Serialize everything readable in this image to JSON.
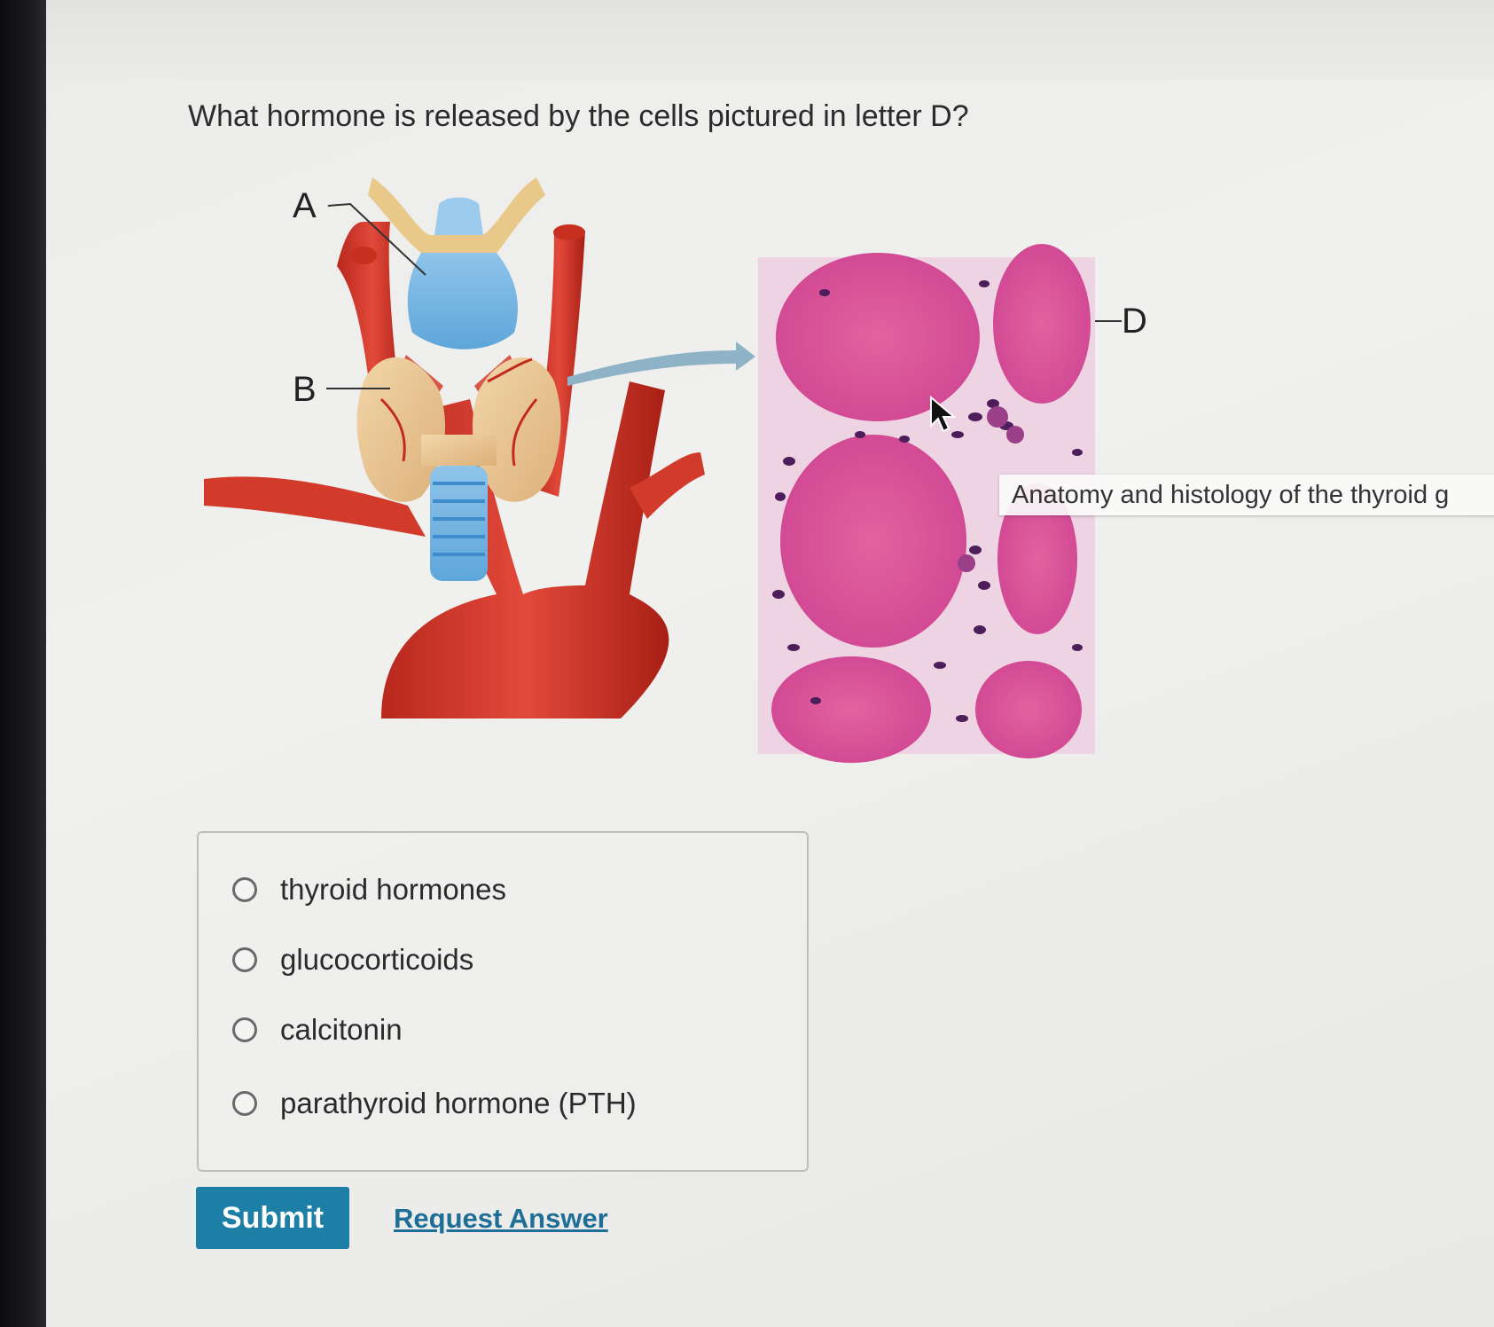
{
  "question": {
    "text": "What hormone is released by the cells pictured in letter D?"
  },
  "figure": {
    "labels": {
      "a": "A",
      "b": "B",
      "d": "D"
    },
    "caption": "Anatomy and histology of the thyroid g"
  },
  "options": [
    {
      "label": "thyroid hormones",
      "selected": false
    },
    {
      "label": "glucocorticoids",
      "selected": false
    },
    {
      "label": "calcitonin",
      "selected": false
    },
    {
      "label": "parathyroid hormone (PTH)",
      "selected": false
    }
  ],
  "actions": {
    "submit_label": "Submit",
    "request_answer_label": "Request Answer"
  },
  "colors": {
    "submit_bg": "#1e7fa6",
    "link": "#1e6e97",
    "histology_pink": "#d9539f"
  },
  "icons": {
    "cursor": "mouse-pointer-icon"
  }
}
